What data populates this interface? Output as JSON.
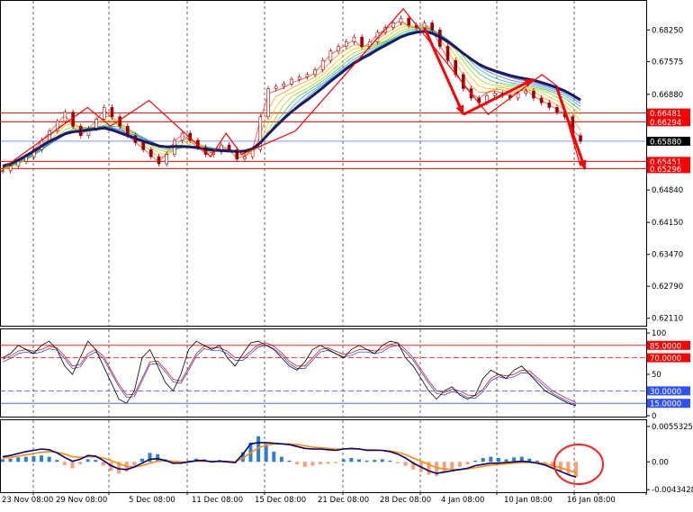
{
  "chart_data": {
    "type": "line",
    "colors": {
      "background": "#ffffff",
      "grid": "#000000",
      "price": "#a00000",
      "slow_ma": "#1a1a66",
      "red_level": "#ff0000",
      "blue_level": "#3050ff",
      "stoch_main": "#000000",
      "stoch_signal": "#cc2020",
      "stoch_third": "#3030cc",
      "macd_pos": "#2f7fd0",
      "macd_neg": "#f4a07a",
      "macd_line": "#000080",
      "macd_signal": "#ff8c00",
      "annotation": "#ff0000"
    },
    "x_labels": [
      "23 Nov 08:00",
      "29 Nov 08:00",
      "5 Dec 08:00",
      "11 Dec 08:00",
      "15 Dec 08:00",
      "21 Dec 08:00",
      "28 Dec 08:00",
      "4 Jan 08:00",
      "10 Jan 08:00",
      "16 Jan 08:00"
    ],
    "price_panel": {
      "y_ticks": [
        "0.68250",
        "0.67575",
        "0.66880",
        "0.64840",
        "0.64150",
        "0.63470",
        "0.62790",
        "0.62110"
      ],
      "level_labels": [
        {
          "text": "0.66481",
          "value": 0.66481,
          "color": "red"
        },
        {
          "text": "0.66294",
          "value": 0.66294,
          "color": "red"
        },
        {
          "text": "0.65880",
          "value": 0.6588,
          "color": "current"
        },
        {
          "text": "0.65451",
          "value": 0.65451,
          "color": "red"
        },
        {
          "text": "0.65296",
          "value": 0.65296,
          "color": "red"
        }
      ],
      "ylim": [
        0.6195,
        0.6885
      ],
      "close": [
        0.6525,
        0.6535,
        0.6545,
        0.6555,
        0.657,
        0.659,
        0.661,
        0.663,
        0.665,
        0.662,
        0.66,
        0.6615,
        0.6635,
        0.666,
        0.664,
        0.662,
        0.66,
        0.6585,
        0.657,
        0.6555,
        0.654,
        0.656,
        0.659,
        0.6605,
        0.659,
        0.6575,
        0.656,
        0.6565,
        0.658,
        0.657,
        0.655,
        0.6555,
        0.657,
        0.664,
        0.67,
        0.6705,
        0.671,
        0.672,
        0.6725,
        0.673,
        0.674,
        0.676,
        0.678,
        0.679,
        0.68,
        0.681,
        0.679,
        0.68,
        0.682,
        0.683,
        0.684,
        0.685,
        0.6835,
        0.683,
        0.684,
        0.6825,
        0.679,
        0.676,
        0.673,
        0.67,
        0.668,
        0.667,
        0.6685,
        0.669,
        0.6685,
        0.668,
        0.669,
        0.6695,
        0.668,
        0.667,
        0.666,
        0.665,
        0.664,
        0.66,
        0.6588
      ],
      "ma": [
        0.6535,
        0.654,
        0.6548,
        0.6557,
        0.6567,
        0.6578,
        0.6588,
        0.6596,
        0.6604,
        0.6608,
        0.661,
        0.6612,
        0.6614,
        0.6616,
        0.6612,
        0.6606,
        0.66,
        0.6594,
        0.6588,
        0.6583,
        0.6578,
        0.6576,
        0.6577,
        0.6577,
        0.6576,
        0.6574,
        0.6571,
        0.6569,
        0.6568,
        0.6567,
        0.6566,
        0.6567,
        0.6572,
        0.6585,
        0.6603,
        0.662,
        0.6636,
        0.6651,
        0.6664,
        0.6676,
        0.6689,
        0.6702,
        0.6716,
        0.6729,
        0.6742,
        0.6754,
        0.6764,
        0.6773,
        0.6783,
        0.6792,
        0.6801,
        0.681,
        0.6816,
        0.682,
        0.6822,
        0.6818,
        0.681,
        0.68,
        0.6788,
        0.6775,
        0.6763,
        0.6752,
        0.6744,
        0.6738,
        0.6733,
        0.6728,
        0.6724,
        0.6721,
        0.6718,
        0.6713,
        0.6708,
        0.6702,
        0.6695,
        0.6686,
        0.6676
      ]
    },
    "stoch_panel": {
      "y_ticks": [
        "100",
        "50",
        "0"
      ],
      "level_labels": [
        {
          "text": "85.0000",
          "value": 85
        },
        {
          "text": "70.0000",
          "value": 70
        },
        {
          "text": "30.0000",
          "value": 30
        },
        {
          "text": "15.0000",
          "value": 15
        }
      ],
      "ylim": [
        0,
        100
      ],
      "main": [
        70,
        75,
        85,
        80,
        75,
        85,
        90,
        80,
        60,
        50,
        70,
        90,
        80,
        60,
        40,
        20,
        15,
        30,
        70,
        80,
        60,
        40,
        30,
        50,
        80,
        90,
        85,
        80,
        85,
        70,
        60,
        75,
        88,
        90,
        85,
        80,
        70,
        60,
        55,
        65,
        80,
        85,
        80,
        75,
        70,
        80,
        85,
        80,
        75,
        85,
        90,
        88,
        70,
        60,
        45,
        30,
        20,
        30,
        35,
        25,
        20,
        25,
        45,
        55,
        50,
        45,
        55,
        60,
        50,
        40,
        30,
        25,
        20,
        15,
        12
      ],
      "signal": [
        68,
        72,
        78,
        80,
        78,
        80,
        84,
        82,
        72,
        60,
        62,
        75,
        80,
        72,
        55,
        38,
        25,
        26,
        45,
        65,
        66,
        56,
        44,
        42,
        58,
        75,
        84,
        82,
        82,
        78,
        70,
        70,
        78,
        86,
        88,
        84,
        76,
        66,
        60,
        60,
        70,
        80,
        82,
        78,
        74,
        76,
        80,
        80,
        78,
        80,
        86,
        88,
        80,
        70,
        56,
        42,
        30,
        28,
        32,
        30,
        25,
        24,
        32,
        45,
        50,
        48,
        50,
        55,
        54,
        46,
        38,
        30,
        25,
        20,
        16
      ]
    },
    "macd_panel": {
      "y_ticks": [
        "0.0055325",
        "0.00",
        "-0.0043428"
      ],
      "ylim": [
        -0.0046,
        0.0058
      ],
      "hist": [
        0.0004,
        0.0005,
        0.0007,
        0.0008,
        0.0009,
        0.001,
        0.0008,
        0.0003,
        -0.0005,
        -0.001,
        -0.0004,
        0.0004,
        0.0003,
        -0.0006,
        -0.0014,
        -0.0018,
        -0.0015,
        -0.0006,
        0.0005,
        0.0014,
        0.0012,
        0.0004,
        -0.0004,
        -0.0003,
        0.0002,
        0.0005,
        0.0004,
        0.0001,
        0.0003,
        0.0001,
        -0.0002,
        0.0015,
        0.003,
        0.004,
        0.0028,
        0.0016,
        0.0008,
        0.0002,
        -0.0004,
        -0.0008,
        -0.0006,
        -0.0004,
        -0.0003,
        -0.0002,
        0.0004,
        0.0006,
        0.0004,
        0.0002,
        0.0003,
        0.0004,
        0.0002,
        -0.0002,
        -0.0006,
        -0.0012,
        -0.0016,
        -0.002,
        -0.0022,
        -0.0016,
        -0.0012,
        -0.0008,
        -0.0004,
        0.0002,
        0.0006,
        0.0008,
        0.0006,
        0.0004,
        0.0007,
        0.0008,
        0.0005,
        0.0002,
        -0.0002,
        -0.0008,
        -0.0014,
        -0.002,
        -0.0024
      ],
      "macd": [
        0.0008,
        0.001,
        0.0013,
        0.0016,
        0.0018,
        0.002,
        0.0019,
        0.0014,
        0.0007,
        0.0001,
        0.0004,
        0.001,
        0.0009,
        0.0002,
        -0.0006,
        -0.0011,
        -0.0012,
        -0.0008,
        -0.0002,
        0.0004,
        0.0005,
        0.0002,
        -0.0002,
        -0.0002,
        0.0,
        0.0002,
        0.0002,
        0.0,
        0.0001,
        0.0,
        -0.0001,
        0.0012,
        0.0028,
        0.003,
        0.003,
        0.0029,
        0.0028,
        0.0027,
        0.0024,
        0.0021,
        0.002,
        0.002,
        0.0019,
        0.0018,
        0.002,
        0.0021,
        0.002,
        0.0018,
        0.0018,
        0.0018,
        0.0016,
        0.0012,
        0.0006,
        -0.0002,
        -0.0008,
        -0.0014,
        -0.0018,
        -0.0016,
        -0.0014,
        -0.0012,
        -0.001,
        -0.0006,
        -0.0004,
        -0.0002,
        -0.0002,
        -0.0001,
        0.0,
        0.0001,
        0.0,
        -0.0002,
        -0.0005,
        -0.001,
        -0.0015,
        -0.002,
        -0.0024
      ],
      "signal": [
        0.0006,
        0.0007,
        0.0009,
        0.0011,
        0.0013,
        0.0015,
        0.0016,
        0.0015,
        0.0012,
        0.0008,
        0.0007,
        0.0008,
        0.0008,
        0.0006,
        0.0002,
        -0.0003,
        -0.0007,
        -0.0008,
        -0.0006,
        -0.0002,
        0.0001,
        0.0002,
        0.0001,
        0.0,
        0.0,
        0.0001,
        0.0001,
        0.0001,
        0.0001,
        0.0001,
        0.0,
        0.0006,
        0.0014,
        0.0022,
        0.0026,
        0.0028,
        0.0028,
        0.0028,
        0.0027,
        0.0025,
        0.0023,
        0.0022,
        0.0021,
        0.002,
        0.002,
        0.002,
        0.002,
        0.0019,
        0.0019,
        0.0018,
        0.0017,
        0.0015,
        0.0011,
        0.0006,
        0.0001,
        -0.0004,
        -0.0009,
        -0.0011,
        -0.0012,
        -0.0012,
        -0.0011,
        -0.0009,
        -0.0007,
        -0.0005,
        -0.0004,
        -0.0003,
        -0.0002,
        -0.0001,
        -0.0001,
        -0.0001,
        -0.0003,
        -0.0006,
        -0.0009,
        -0.0013,
        -0.0017
      ]
    }
  }
}
